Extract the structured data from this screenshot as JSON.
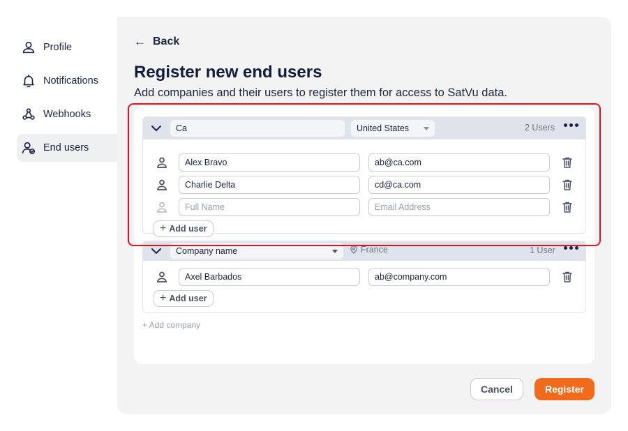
{
  "sidebar": {
    "items": [
      {
        "label": "Profile",
        "icon": "user-icon"
      },
      {
        "label": "Notifications",
        "icon": "bell-icon"
      },
      {
        "label": "Webhooks",
        "icon": "webhook-icon"
      },
      {
        "label": "End users",
        "icon": "user-check-icon",
        "active": true
      }
    ]
  },
  "header": {
    "back_label": "Back",
    "title": "Register new end users",
    "subtitle": "Add companies and their users to register them for access to SatVu data."
  },
  "companies": [
    {
      "name_value": "Ca",
      "country": "United States",
      "users_count": "2 Users",
      "users": [
        {
          "name": "Alex Bravo",
          "email": "ab@ca.com"
        },
        {
          "name": "Charlie Delta",
          "email": "cd@ca.com"
        }
      ],
      "new_user": {
        "name_placeholder": "Full Name",
        "email_placeholder": "Email Address"
      },
      "add_user_label": "Add user"
    },
    {
      "name_value": "Company name",
      "country": "France",
      "users_count": "1 User",
      "users": [
        {
          "name": "Axel Barbados",
          "email": "ab@company.com"
        }
      ],
      "add_user_label": "Add user"
    }
  ],
  "add_company_label": "+ Add company",
  "actions": {
    "cancel_label": "Cancel",
    "register_label": "Register"
  },
  "colors": {
    "accent": "#f26a1b",
    "highlight": "#e0141e",
    "company_header": "#dfe4ec"
  }
}
